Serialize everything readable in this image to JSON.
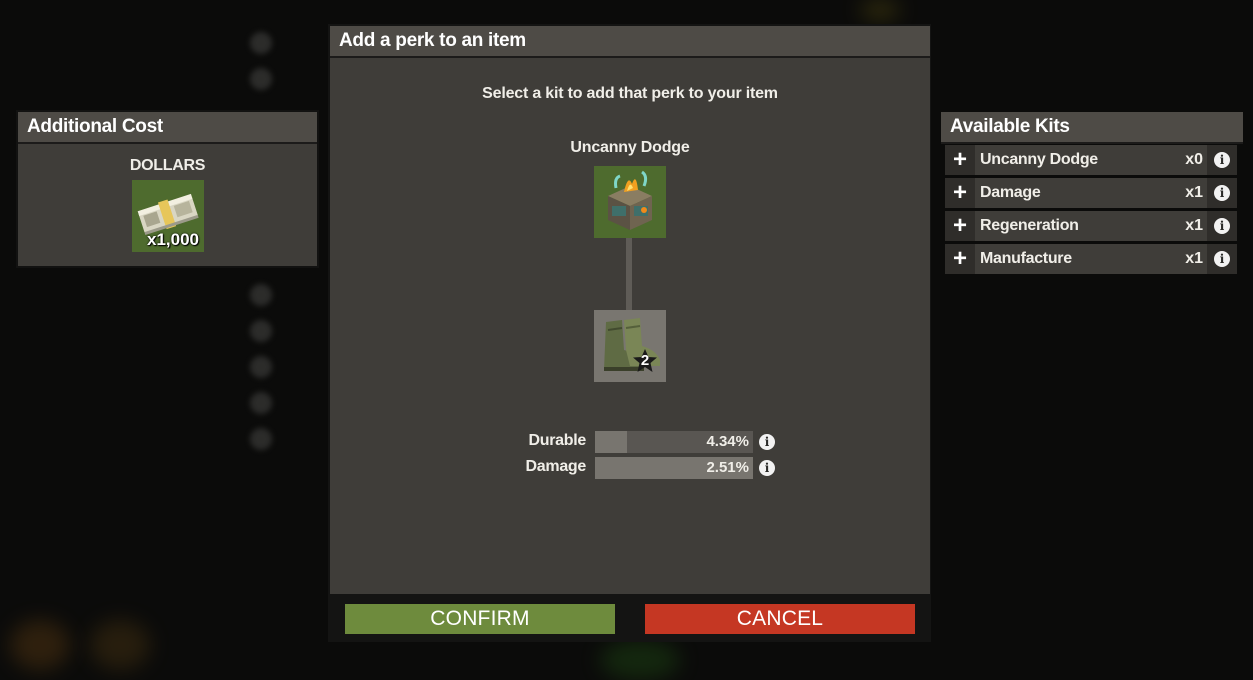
{
  "cost_panel": {
    "title": "Additional Cost",
    "currency_label": "DOLLARS",
    "item_icon": "cash-stack-icon",
    "quantity": "x1,000"
  },
  "dialog": {
    "title": "Add a perk to an item",
    "instruction": "Select a kit to add that perk to your item",
    "perk_name": "Uncanny Dodge",
    "perk_icon": "mod-kit-crate-icon",
    "item_icon": "boots-icon",
    "item_tier": "2",
    "stats": [
      {
        "label": "Durable",
        "value": "4.34%",
        "fill": 0.2
      },
      {
        "label": "Damage",
        "value": "2.51%",
        "fill": 1.0
      }
    ],
    "confirm_label": "CONFIRM",
    "cancel_label": "CANCEL"
  },
  "kits_panel": {
    "title": "Available Kits",
    "kits": [
      {
        "name": "Uncanny Dodge",
        "count": "x0"
      },
      {
        "name": "Damage",
        "count": "x1"
      },
      {
        "name": "Regeneration",
        "count": "x1"
      },
      {
        "name": "Manufacture",
        "count": "x1"
      }
    ]
  },
  "colors": {
    "confirm": "#6e8b3d",
    "cancel": "#c53723",
    "header": "#4e4b46",
    "panel": "#3f3d39",
    "icon_bg_green": "#4e6b2e"
  }
}
